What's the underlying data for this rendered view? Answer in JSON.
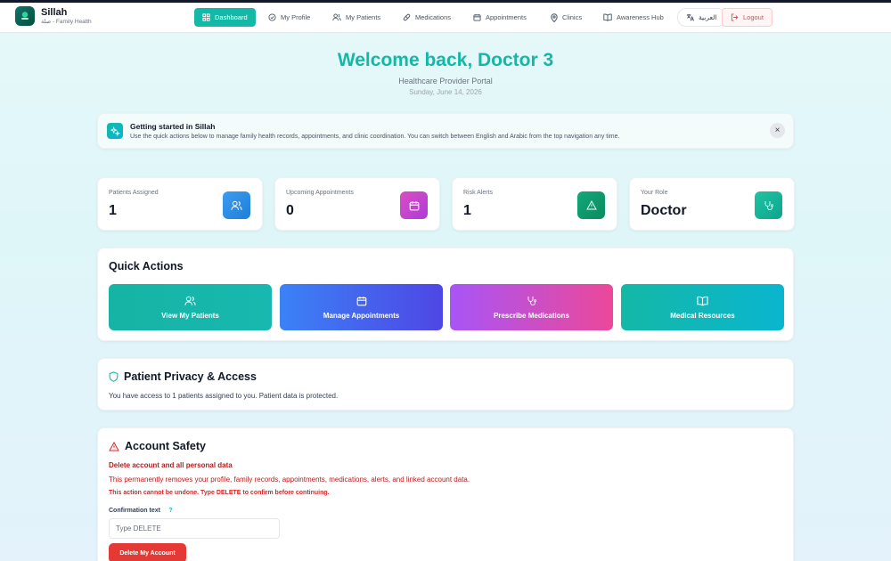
{
  "app": {
    "name": "Sillah",
    "subtitle": "صلة - Family Health"
  },
  "nav": {
    "items": [
      {
        "label": "Dashboard",
        "icon": "grid-icon",
        "active": true
      },
      {
        "label": "My Profile",
        "icon": "check-circle-icon"
      },
      {
        "label": "My Patients",
        "icon": "users-icon"
      },
      {
        "label": "Medications",
        "icon": "pill-icon"
      },
      {
        "label": "Appointments",
        "icon": "calendar-icon"
      },
      {
        "label": "Clinics",
        "icon": "map-pin-icon"
      },
      {
        "label": "Awareness Hub",
        "icon": "book-icon"
      }
    ],
    "language": "العربية",
    "logout": "Logout"
  },
  "header": {
    "welcome": "Welcome back, Doctor 3",
    "portal": "Healthcare Provider Portal",
    "date": "Sunday, June 14, 2026"
  },
  "banner": {
    "title": "Getting started in Sillah",
    "text": "Use the quick actions below to manage family health records, appointments, and clinic coordination. You can switch between English and Arabic from the top navigation any time.",
    "close": "×"
  },
  "stats": [
    {
      "label": "Patients Assigned",
      "value": "1",
      "icon": "users-icon",
      "color": "#2b8fe6"
    },
    {
      "label": "Upcoming Appointments",
      "value": "0",
      "icon": "calendar-icon",
      "color": "#c447cf"
    },
    {
      "label": "Risk Alerts",
      "value": "1",
      "icon": "alert-triangle-icon",
      "color": "#0f9d6e"
    },
    {
      "label": "Your Role",
      "value": "Doctor",
      "icon": "stethoscope-icon",
      "color": "#16b39a"
    }
  ],
  "quick_actions": {
    "title": "Quick Actions",
    "items": [
      {
        "label": "View My Patients",
        "icon": "users-icon"
      },
      {
        "label": "Manage Appointments",
        "icon": "calendar-icon"
      },
      {
        "label": "Prescribe Medications",
        "icon": "stethoscope-icon"
      },
      {
        "label": "Medical Resources",
        "icon": "book-icon"
      }
    ]
  },
  "privacy": {
    "title": "Patient Privacy & Access",
    "text": "You have access to 1 patients assigned to you. Patient data is protected."
  },
  "safety": {
    "title": "Account Safety",
    "heading": "Delete account and all personal data",
    "description": "This permanently removes your profile, family records, appointments, medications, alerts, and linked account data.",
    "warning": "This action cannot be undone. Type DELETE to confirm before continuing.",
    "confirm_label": "Confirmation text",
    "help": "?",
    "input_placeholder": "Type DELETE",
    "input_value": "",
    "delete_button": "Delete My Account"
  }
}
